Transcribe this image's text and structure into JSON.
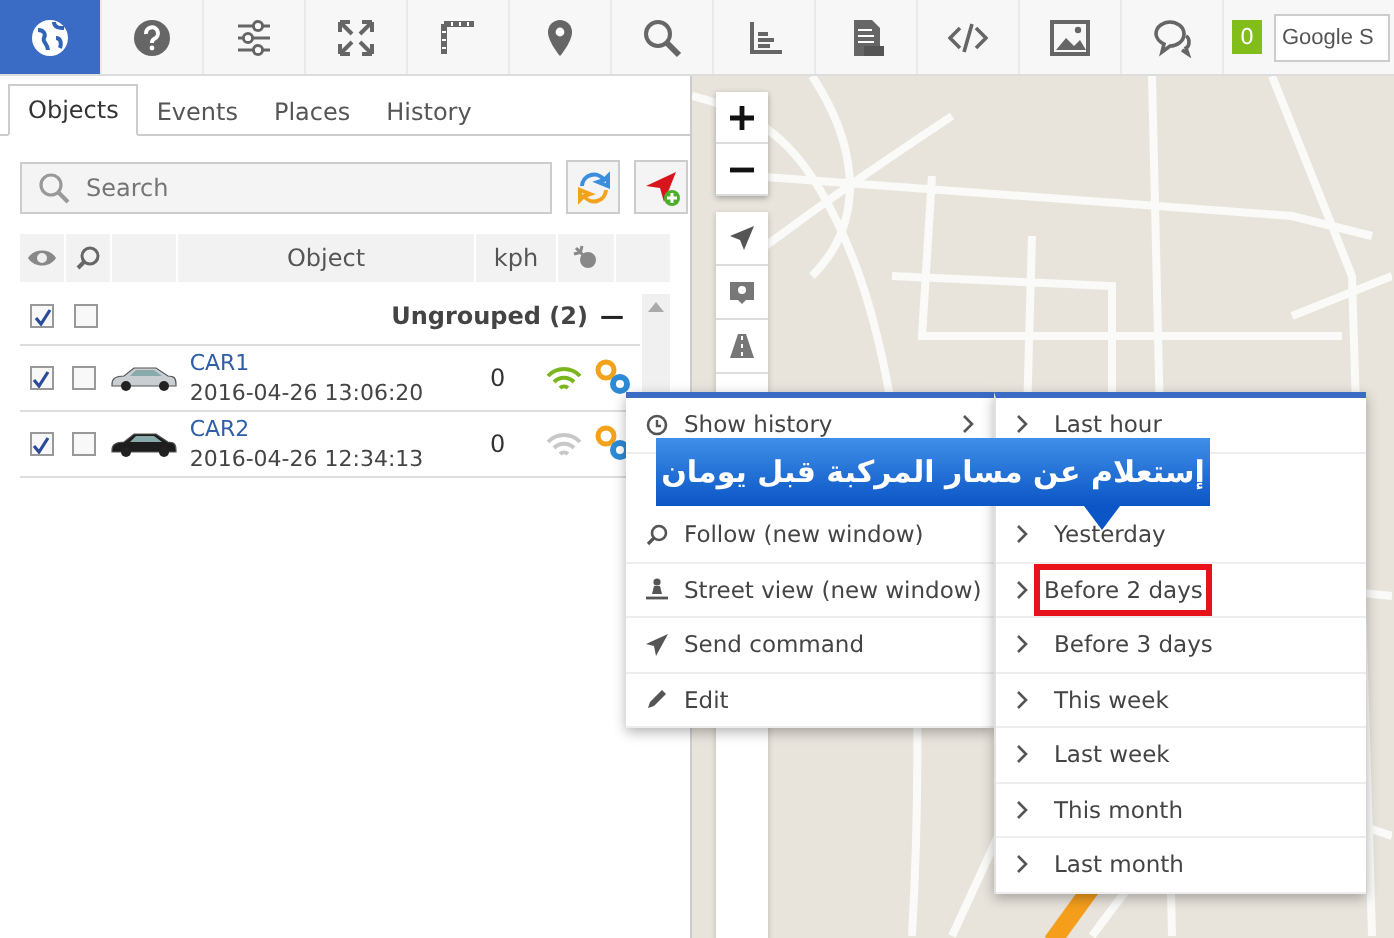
{
  "toolbar": {
    "buttons": [
      {
        "selected": true
      },
      {
        "selected": false
      },
      {
        "selected": false
      },
      {
        "selected": false
      },
      {
        "selected": false
      },
      {
        "selected": false
      },
      {
        "selected": false
      },
      {
        "selected": false
      },
      {
        "selected": false
      },
      {
        "selected": false
      },
      {
        "selected": false
      },
      {
        "selected": false
      }
    ],
    "badge": "0",
    "search_value": "Google S"
  },
  "tabs": [
    {
      "label": "Objects",
      "selected": true
    },
    {
      "label": "Events",
      "selected": false
    },
    {
      "label": "Places",
      "selected": false
    },
    {
      "label": "History",
      "selected": false
    }
  ],
  "search": {
    "placeholder": "Search"
  },
  "table": {
    "columns": [
      "Object",
      "kph"
    ],
    "group": {
      "label": "Ungrouped (2)",
      "visible": true,
      "followed": false,
      "collapse": "—"
    },
    "rows": [
      {
        "name": "CAR1",
        "time": "2016-04-26 13:06:20",
        "speed": "0",
        "visible": true,
        "followed": false,
        "online": true
      },
      {
        "name": "CAR2",
        "time": "2016-04-26 12:34:13",
        "speed": "0",
        "visible": true,
        "followed": false,
        "online": false
      }
    ]
  },
  "context_menu": {
    "items": [
      {
        "label": "Show history",
        "submenu": true
      },
      {
        "label": "Follow (new window)",
        "submenu": false
      },
      {
        "label": "Street view (new window)",
        "submenu": false
      },
      {
        "label": "Send command",
        "submenu": false
      },
      {
        "label": "Edit",
        "submenu": false
      }
    ],
    "submenu": [
      {
        "label": "Last hour",
        "highlighted": false
      },
      {
        "label": "Yesterday",
        "highlighted": false
      },
      {
        "label": "Before 2 days",
        "highlighted": true
      },
      {
        "label": "Before 3 days",
        "highlighted": false
      },
      {
        "label": "This week",
        "highlighted": false
      },
      {
        "label": "Last week",
        "highlighted": false
      },
      {
        "label": "This month",
        "highlighted": false
      },
      {
        "label": "Last month",
        "highlighted": false
      }
    ]
  },
  "callout": {
    "text": "إستعلام عن مسار المركبة قبل يومان"
  }
}
